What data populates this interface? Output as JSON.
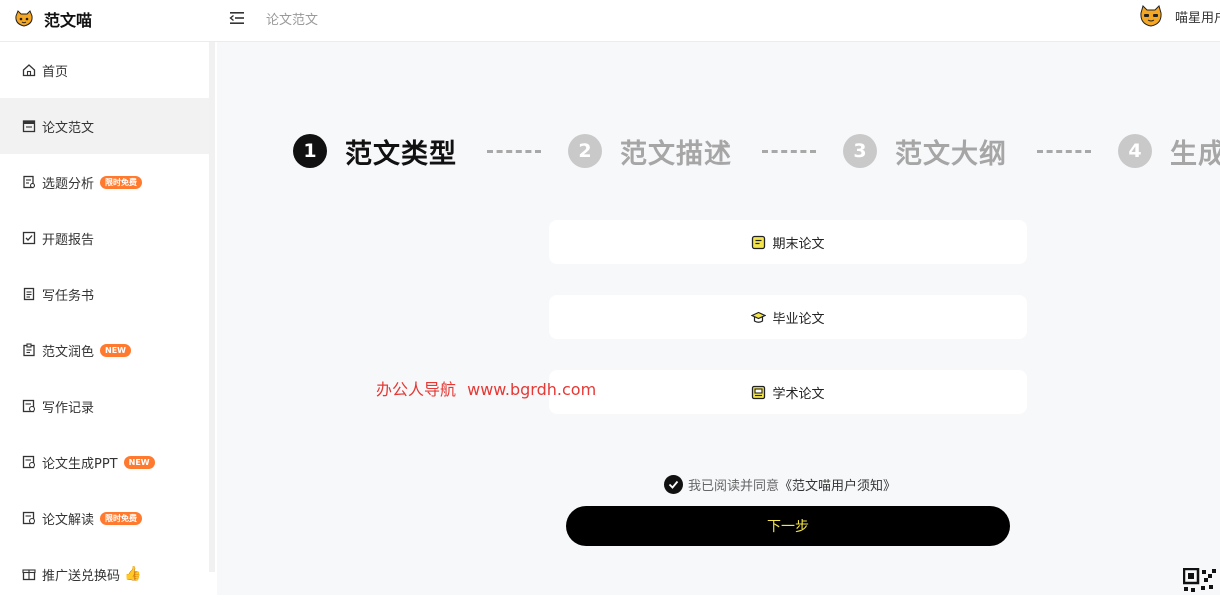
{
  "app": {
    "title": "范文喵",
    "breadcrumb": "论文范文",
    "user_name": "喵星用户"
  },
  "sidebar": {
    "items": [
      {
        "label": "首页",
        "icon": "home-icon"
      },
      {
        "label": "论文范文",
        "icon": "document-icon",
        "active": true
      },
      {
        "label": "选题分析",
        "icon": "analysis-icon",
        "badge": "限时免费"
      },
      {
        "label": "开题报告",
        "icon": "checklist-icon"
      },
      {
        "label": "写任务书",
        "icon": "book-icon"
      },
      {
        "label": "范文润色",
        "icon": "polish-icon",
        "badge": "NEW"
      },
      {
        "label": "写作记录",
        "icon": "record-icon"
      },
      {
        "label": "论文生成PPT",
        "icon": "ppt-icon",
        "badge": "NEW"
      },
      {
        "label": "论文解读",
        "icon": "read-icon",
        "badge": "限时免费"
      },
      {
        "label": "推广送兑换码",
        "icon": "gift-icon",
        "extra_icon": "thumbs-up-icon"
      }
    ]
  },
  "steps": [
    {
      "number": "1",
      "label": "范文类型",
      "active": true
    },
    {
      "number": "2",
      "label": "范文描述",
      "active": false
    },
    {
      "number": "3",
      "label": "范文大纲",
      "active": false
    },
    {
      "number": "4",
      "label": "生成",
      "active": false
    }
  ],
  "options": [
    {
      "label": "期末论文",
      "icon": "note-icon"
    },
    {
      "label": "毕业论文",
      "icon": "graduation-cap-icon"
    },
    {
      "label": "学术论文",
      "icon": "academic-icon"
    }
  ],
  "watermark": {
    "text": "办公人导航",
    "url": "www.bgrdh.com"
  },
  "agreement": {
    "text": "我已阅读并同意",
    "link": "《范文喵用户须知》"
  },
  "next_button": "下一步",
  "colors": {
    "accent": "#000000",
    "button_text": "#f4e64a",
    "badge": "#ff7a2e",
    "watermark": "#e53935",
    "inactive_step": "#c9c9c9"
  }
}
